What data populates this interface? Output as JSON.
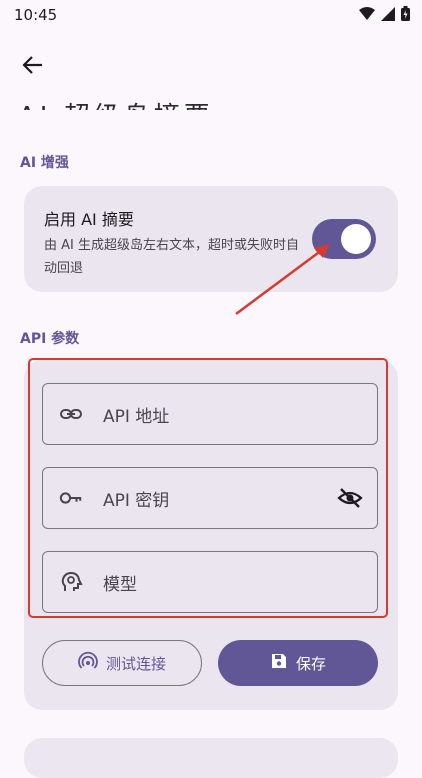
{
  "status_bar": {
    "time": "10:45",
    "icons": [
      "wifi-icon",
      "signal-icon",
      "battery-icon"
    ]
  },
  "header": {
    "back_icon": "arrow-left-icon",
    "title_partial": "AI 超级岛摘要"
  },
  "ai_section": {
    "label": "AI 增强",
    "toggle_title": "启用 AI 摘要",
    "toggle_desc": "由 AI 生成超级岛左右文本，超时或失败时自动回退",
    "toggle_on": true
  },
  "api_section": {
    "label": "API 参数",
    "fields": [
      {
        "label": "API 地址",
        "icon": "link-icon"
      },
      {
        "label": "API 密钥",
        "icon": "key-icon",
        "trailing_icon": "visibility-off-icon"
      },
      {
        "label": "模型",
        "icon": "brain-head-icon"
      }
    ],
    "test_button": "测试连接",
    "save_button": "保存"
  },
  "colors": {
    "accent": "#625796",
    "card": "#ebe5ef",
    "background": "#fcf6fd",
    "annotation": "#d73a2f"
  }
}
